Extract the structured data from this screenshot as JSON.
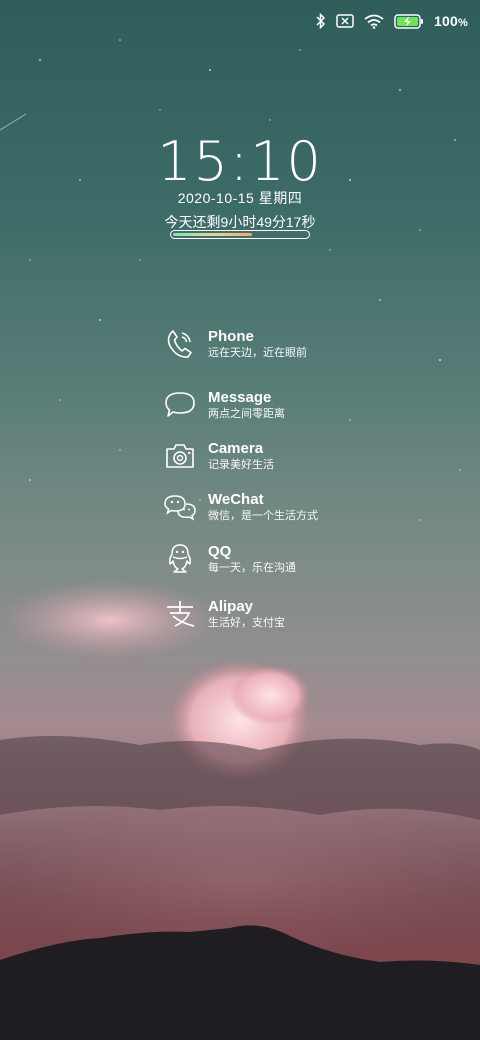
{
  "status_bar": {
    "icons": [
      "bluetooth-icon",
      "no-sim-icon",
      "wifi-icon",
      "battery-charging-icon"
    ],
    "battery_text": "100",
    "battery_percent_sign": "%"
  },
  "lockscreen": {
    "time": "15:10",
    "date": "2020-10-15  星期四",
    "remaining": "今天还剩9小时49分17秒",
    "day_progress": 0.59
  },
  "apps": [
    {
      "name": "Phone",
      "subtitle": "远在天边，近在眼前",
      "icon": "phone-icon"
    },
    {
      "name": "Message",
      "subtitle": "两点之间零距离",
      "icon": "message-icon"
    },
    {
      "name": "Camera",
      "subtitle": "记录美好生活",
      "icon": "camera-icon"
    },
    {
      "name": "WeChat",
      "subtitle": "微信，是一个生活方式",
      "icon": "wechat-icon"
    },
    {
      "name": "QQ",
      "subtitle": "每一天，乐在沟通",
      "icon": "qq-icon"
    },
    {
      "name": "Alipay",
      "subtitle": "生活好，支付宝",
      "icon": "alipay-icon"
    }
  ]
}
